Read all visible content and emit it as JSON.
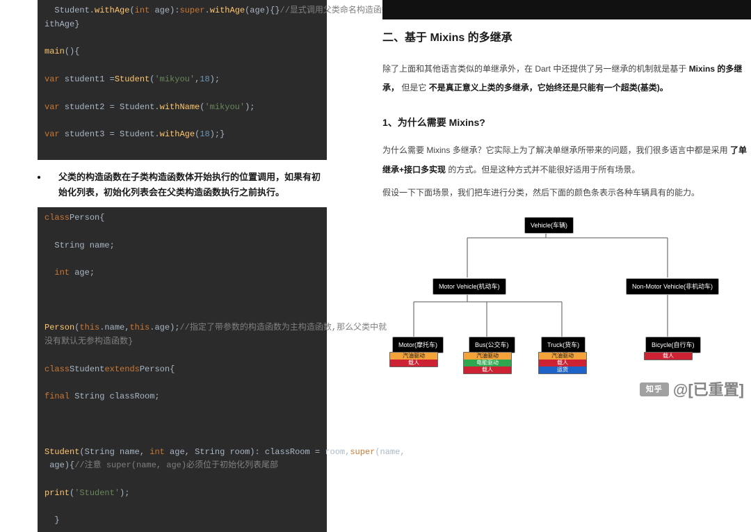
{
  "left": {
    "code1_lines": [
      {
        "segs": [
          {
            "t": "  Student.",
            "c": ""
          },
          {
            "t": "withAge",
            "c": "fn"
          },
          {
            "t": "(",
            "c": ""
          },
          {
            "t": "int",
            "c": "kw"
          },
          {
            "t": " age):",
            "c": ""
          },
          {
            "t": "super",
            "c": "kw"
          },
          {
            "t": ".",
            "c": ""
          },
          {
            "t": "withAge",
            "c": "fn"
          },
          {
            "t": "(age){}",
            "c": ""
          },
          {
            "t": "//显式调用父类命名构造函数w",
            "c": "cm"
          }
        ]
      },
      {
        "segs": [
          {
            "t": "ithAge}",
            "c": ""
          }
        ]
      },
      {
        "segs": [
          {
            "t": "",
            "c": ""
          }
        ]
      },
      {
        "segs": [
          {
            "t": "main",
            "c": "fn"
          },
          {
            "t": "(){",
            "c": ""
          }
        ]
      },
      {
        "segs": [
          {
            "t": "",
            "c": ""
          }
        ]
      },
      {
        "segs": [
          {
            "t": "var",
            "c": "kw"
          },
          {
            "t": " student1 =",
            "c": ""
          },
          {
            "t": "Student",
            "c": "fn"
          },
          {
            "t": "(",
            "c": ""
          },
          {
            "t": "'mikyou'",
            "c": "str"
          },
          {
            "t": ",",
            "c": ""
          },
          {
            "t": "18",
            "c": "num"
          },
          {
            "t": ");",
            "c": ""
          }
        ]
      },
      {
        "segs": [
          {
            "t": "",
            "c": ""
          }
        ]
      },
      {
        "segs": [
          {
            "t": "var",
            "c": "kw"
          },
          {
            "t": " student2 = Student.",
            "c": ""
          },
          {
            "t": "withName",
            "c": "fn"
          },
          {
            "t": "(",
            "c": ""
          },
          {
            "t": "'mikyou'",
            "c": "str"
          },
          {
            "t": ");",
            "c": ""
          }
        ]
      },
      {
        "segs": [
          {
            "t": "",
            "c": ""
          }
        ]
      },
      {
        "segs": [
          {
            "t": "var",
            "c": "kw"
          },
          {
            "t": " student3 = Student.",
            "c": ""
          },
          {
            "t": "withAge",
            "c": "fn"
          },
          {
            "t": "(",
            "c": ""
          },
          {
            "t": "18",
            "c": "num"
          },
          {
            "t": ");}",
            "c": ""
          }
        ]
      },
      {
        "segs": [
          {
            "t": "",
            "c": ""
          }
        ]
      }
    ],
    "bullet_text": "父类的构造函数在子类构造函数体开始执行的位置调用，如果有初始化列表，初始化列表会在父类构造函数执行之前执行。",
    "code2_lines": [
      {
        "segs": [
          {
            "t": "class",
            "c": "kw"
          },
          {
            "t": "Person{",
            "c": ""
          }
        ]
      },
      {
        "segs": [
          {
            "t": "",
            "c": ""
          }
        ]
      },
      {
        "segs": [
          {
            "t": "  String name;",
            "c": ""
          }
        ]
      },
      {
        "segs": [
          {
            "t": "",
            "c": ""
          }
        ]
      },
      {
        "segs": [
          {
            "t": "  ",
            "c": ""
          },
          {
            "t": "int",
            "c": "kw"
          },
          {
            "t": " age;",
            "c": ""
          }
        ]
      },
      {
        "segs": [
          {
            "t": "",
            "c": ""
          }
        ]
      },
      {
        "segs": [
          {
            "t": "",
            "c": ""
          }
        ]
      },
      {
        "segs": [
          {
            "t": "",
            "c": ""
          }
        ]
      },
      {
        "segs": [
          {
            "t": "Person",
            "c": "fn"
          },
          {
            "t": "(",
            "c": ""
          },
          {
            "t": "this",
            "c": "kw"
          },
          {
            "t": ".name,",
            "c": ""
          },
          {
            "t": "this",
            "c": "kw"
          },
          {
            "t": ".age);",
            "c": ""
          },
          {
            "t": "//指定了带参数的构造函数为主构造函数,那么父类中就",
            "c": "cm"
          }
        ]
      },
      {
        "segs": [
          {
            "t": "没有默认无参构造函数}",
            "c": "cm"
          }
        ]
      },
      {
        "segs": [
          {
            "t": "",
            "c": ""
          }
        ]
      },
      {
        "segs": [
          {
            "t": "class",
            "c": "kw"
          },
          {
            "t": "Student",
            "c": ""
          },
          {
            "t": "extends",
            "c": "kw"
          },
          {
            "t": "Person{",
            "c": ""
          }
        ]
      },
      {
        "segs": [
          {
            "t": "",
            "c": ""
          }
        ]
      },
      {
        "segs": [
          {
            "t": "final",
            "c": "kw"
          },
          {
            "t": " String classRoom;",
            "c": ""
          }
        ]
      },
      {
        "segs": [
          {
            "t": "",
            "c": ""
          }
        ]
      },
      {
        "segs": [
          {
            "t": "",
            "c": ""
          }
        ]
      },
      {
        "segs": [
          {
            "t": "",
            "c": ""
          }
        ]
      },
      {
        "segs": [
          {
            "t": "Student",
            "c": "fn"
          },
          {
            "t": "(String name, ",
            "c": ""
          },
          {
            "t": "int",
            "c": "kw"
          },
          {
            "t": " age, String room): classRoom = room,",
            "c": ""
          },
          {
            "t": "super",
            "c": "kw"
          },
          {
            "t": "(name,",
            "c": ""
          }
        ]
      },
      {
        "segs": [
          {
            "t": " age){",
            "c": ""
          },
          {
            "t": "//注意 super(name, age)必须位于初始化列表尾部",
            "c": "cm"
          }
        ]
      },
      {
        "segs": [
          {
            "t": "",
            "c": ""
          }
        ]
      },
      {
        "segs": [
          {
            "t": "print",
            "c": "fn"
          },
          {
            "t": "(",
            "c": ""
          },
          {
            "t": "'Student'",
            "c": "str"
          },
          {
            "t": ");",
            "c": ""
          }
        ]
      },
      {
        "segs": [
          {
            "t": "",
            "c": ""
          }
        ]
      },
      {
        "segs": [
          {
            "t": "  }",
            "c": ""
          }
        ]
      }
    ]
  },
  "right": {
    "h2": "二、基于 Mixins 的多继承",
    "p1_pre": "除了上面和其他语言类似的单继承外，在 Dart 中还提供了另一继承的机制就是基于 ",
    "p1_b1": "Mixins 的多继承，",
    "p1_mid": "但是它",
    "p1_b2": "不是真正意义上类的多继承，它始终还是只能有一个超类(基类)。",
    "h3": "1、为什么需要 Mixins?",
    "p2_pre": "为什么需要 Mixins 多继承？它实际上为了解决单继承所带来的问题，我们很多语言中都是采用",
    "p2_b": "了单继承+接口多实现",
    "p2_post": "的方式。但是这种方式并不能很好适用于所有场景。",
    "p3": "假设一下下面场景，我们把车进行分类，然后下面的颜色条表示各种车辆具有的能力。",
    "diagram": {
      "root": "Vehicle(车辆)",
      "mv": "Motor Vehicle(机动车)",
      "nmv": "Non-Motor Vehicle(非机动车)",
      "leaves": [
        "Motor(摩托车)",
        "Bus(公交车)",
        "Truck(货车)",
        "Bicycle(自行车)"
      ],
      "abilities": [
        {
          "rows": [
            "汽油驱动",
            "载人"
          ]
        },
        {
          "rows": [
            "汽油驱动",
            "电能驱动",
            "载人"
          ]
        },
        {
          "rows": [
            "汽油驱动",
            "载人",
            "运货"
          ]
        },
        {
          "rows": [
            "载人"
          ]
        }
      ]
    },
    "watermark": "@[已重置]",
    "logo": "知乎"
  }
}
